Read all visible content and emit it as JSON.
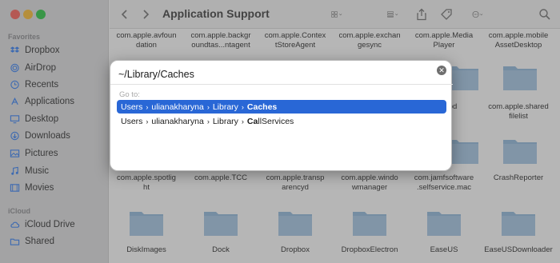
{
  "window": {
    "title": "Application Support"
  },
  "sidebar": {
    "favorites_heading": "Favorites",
    "items": [
      {
        "label": "Dropbox",
        "icon": "dropbox-icon"
      },
      {
        "label": "AirDrop",
        "icon": "airdrop-icon"
      },
      {
        "label": "Recents",
        "icon": "clock-icon"
      },
      {
        "label": "Applications",
        "icon": "applications-icon"
      },
      {
        "label": "Desktop",
        "icon": "desktop-icon"
      },
      {
        "label": "Downloads",
        "icon": "download-icon"
      },
      {
        "label": "Pictures",
        "icon": "pictures-icon"
      },
      {
        "label": "Music",
        "icon": "music-icon"
      },
      {
        "label": "Movies",
        "icon": "movies-icon"
      }
    ],
    "icloud_heading": "iCloud",
    "icloud_items": [
      {
        "label": "iCloud Drive",
        "icon": "cloud-icon"
      },
      {
        "label": "Shared",
        "icon": "shared-icon"
      }
    ]
  },
  "files": {
    "row1": [
      {
        "line1": "com.apple.avfoun",
        "line2": "dation"
      },
      {
        "line1": "com.apple.backgr",
        "line2": "oundtas...ntagent"
      },
      {
        "line1": "com.apple.Contex",
        "line2": "tStoreAgent"
      },
      {
        "line1": "com.apple.exchan",
        "line2": "gesync"
      },
      {
        "line1": "com.apple.Media",
        "line2": "Player"
      },
      {
        "line1": "com.apple.mobile",
        "line2": "AssetDesktop"
      }
    ],
    "row2_partial": [
      {
        "line1": "...ple.sbd",
        "line2": ""
      },
      {
        "line1": "com.apple.shared",
        "line2": "filelist"
      }
    ],
    "row3": [
      {
        "line1": "com.apple.spotlig",
        "line2": "ht"
      },
      {
        "line1": "com.apple.TCC",
        "line2": ""
      },
      {
        "line1": "com.apple.transp",
        "line2": "arencyd"
      },
      {
        "line1": "com.apple.windo",
        "line2": "wmanager"
      },
      {
        "line1": "com.jamfsoftware",
        "line2": ".selfservice.mac"
      },
      {
        "line1": "CrashReporter",
        "line2": ""
      }
    ],
    "row4": [
      {
        "line1": "DiskImages"
      },
      {
        "line1": "Dock"
      },
      {
        "line1": "Dropbox"
      },
      {
        "line1": "DropboxElectron"
      },
      {
        "line1": "EaseUS"
      },
      {
        "line1": "EaseUSDownloader"
      }
    ]
  },
  "dialog": {
    "path_value": "~/Library/Caches",
    "goto_label": "Go to:",
    "suggestions": [
      {
        "parts": [
          "Users",
          "ulianakharyna",
          "Library"
        ],
        "last": "Caches",
        "last_bold": "Caches",
        "selected": true
      },
      {
        "parts": [
          "Users",
          "ulianakharyna",
          "Library"
        ],
        "last_bold": "Ca",
        "last_rest": "llServices",
        "selected": false
      }
    ],
    "separator": "›"
  },
  "colors": {
    "selection": "#2967d6",
    "folder": "#8fb8dc",
    "accent": "#2f7cf6"
  }
}
